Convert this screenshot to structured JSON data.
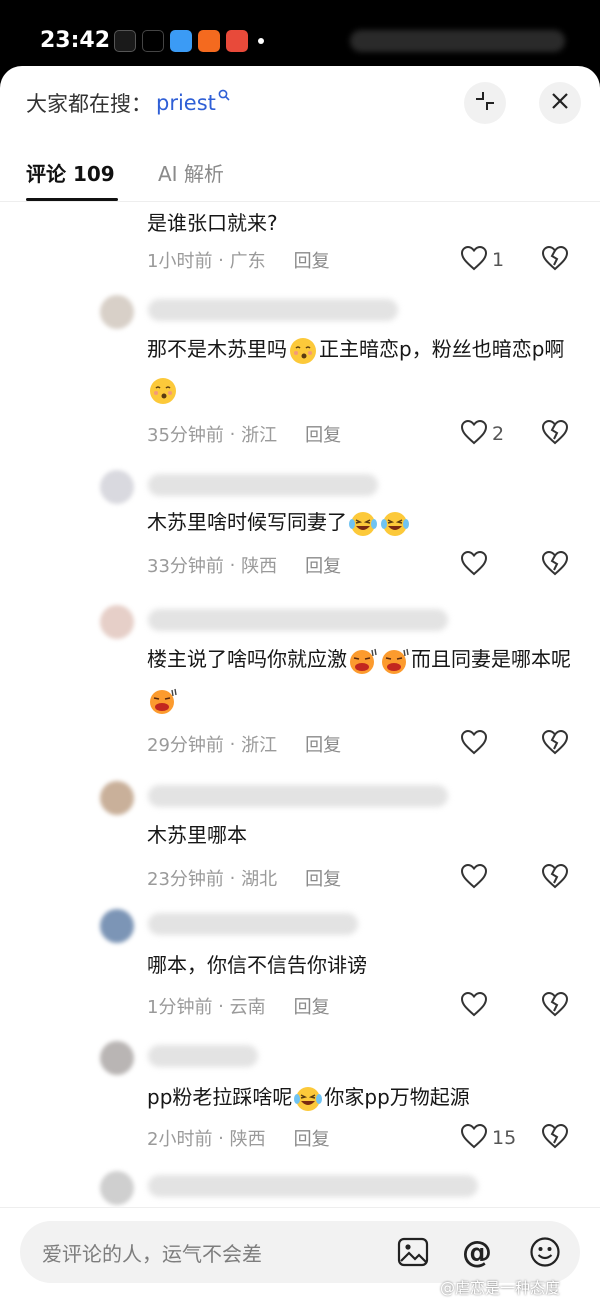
{
  "status_bar": {
    "time": "23:42"
  },
  "header": {
    "search_prefix": "大家都在搜：",
    "search_term": "priest"
  },
  "tabs": [
    {
      "label": "评论 109",
      "active": true
    },
    {
      "label": "AI 解析",
      "active": false
    }
  ],
  "comments": [
    {
      "text_parts": [
        "是谁张口就来?"
      ],
      "time": "1小时前",
      "location": "广东",
      "reply": "回复",
      "likes": "1"
    },
    {
      "text_parts": [
        "那不是木苏里吗",
        "正主暗恋p，粉丝也暗恋p啊",
        ""
      ],
      "time": "35分钟前",
      "location": "浙江",
      "reply": "回复",
      "likes": "2"
    },
    {
      "text_parts": [
        "木苏里啥时候写同妻了",
        ""
      ],
      "time": "33分钟前",
      "location": "陕西",
      "reply": "回复",
      "likes": ""
    },
    {
      "text_parts": [
        "楼主说了啥吗你就应激",
        "而且同妻是哪本呢",
        ""
      ],
      "time": "29分钟前",
      "location": "浙江",
      "reply": "回复",
      "likes": ""
    },
    {
      "text_parts": [
        "木苏里哪本"
      ],
      "time": "23分钟前",
      "location": "湖北",
      "reply": "回复",
      "likes": ""
    },
    {
      "text_parts": [
        "哪本，你信不信告你诽谤"
      ],
      "time": "1分钟前",
      "location": "云南",
      "reply": "回复",
      "likes": ""
    },
    {
      "text_parts": [
        "pp粉老拉踩啥呢",
        "你家pp万物起源"
      ],
      "time": "2小时前",
      "location": "陕西",
      "reply": "回复",
      "likes": "15"
    }
  ],
  "composer": {
    "placeholder": "爱评论的人，运气不会差"
  },
  "watermark": "@虐恋是一种态度",
  "colors": {
    "accent_link": "#2f5fd6",
    "meta_gray": "#9a9a9a",
    "text": "#161616"
  }
}
